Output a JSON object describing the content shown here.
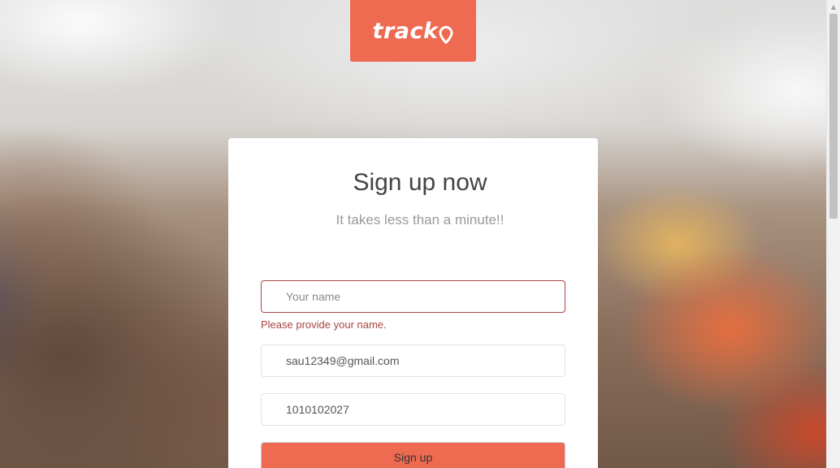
{
  "brand": {
    "name": "track",
    "logo_icon": "location-pin-icon",
    "color": "#ee6a50"
  },
  "form": {
    "title": "Sign up now",
    "subtitle": "It takes less than a minute!!",
    "name": {
      "placeholder": "Your name",
      "value": "",
      "error": "Please provide your name."
    },
    "email": {
      "value": "sau12349@gmail.com"
    },
    "phone": {
      "value": "1010102027"
    },
    "submit_label": "Sign up"
  },
  "colors": {
    "error": "#a94442",
    "accent": "#ee6a50"
  },
  "scrollbar": {
    "up_arrow_icon": "chevron-up-icon",
    "up_arrow_glyph": "▲"
  }
}
